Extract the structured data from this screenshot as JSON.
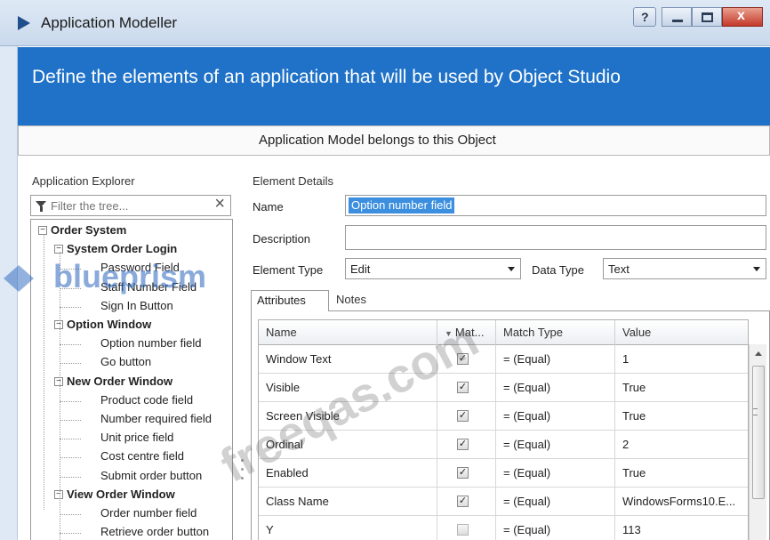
{
  "window": {
    "title": "Application Modeller",
    "help_glyph": "?",
    "close_glyph": "x"
  },
  "banner": {
    "text": "Define the elements of an application that will be used by Object Studio"
  },
  "model_bar": {
    "text": "Application Model belongs to this Object"
  },
  "explorer": {
    "title": "Application Explorer",
    "filter_placeholder": "Filter the tree...",
    "tree": [
      {
        "label": "Order System",
        "level": 0,
        "bold": true
      },
      {
        "label": "System Order Login",
        "level": 1,
        "bold": true
      },
      {
        "label": "Password Field",
        "level": 2,
        "bold": false
      },
      {
        "label": "Staff Number Field",
        "level": 2,
        "bold": false
      },
      {
        "label": "Sign In Button",
        "level": 2,
        "bold": false
      },
      {
        "label": "Option Window",
        "level": 1,
        "bold": true
      },
      {
        "label": "Option number field",
        "level": 2,
        "bold": false
      },
      {
        "label": "Go button",
        "level": 2,
        "bold": false
      },
      {
        "label": "New Order Window",
        "level": 1,
        "bold": true
      },
      {
        "label": "Product code field",
        "level": 2,
        "bold": false
      },
      {
        "label": "Number required field",
        "level": 2,
        "bold": false
      },
      {
        "label": "Unit price field",
        "level": 2,
        "bold": false
      },
      {
        "label": "Cost centre field",
        "level": 2,
        "bold": false
      },
      {
        "label": "Submit order button",
        "level": 2,
        "bold": false
      },
      {
        "label": "View Order Window",
        "level": 1,
        "bold": true
      },
      {
        "label": "Order number field",
        "level": 2,
        "bold": false
      },
      {
        "label": "Retrieve order button",
        "level": 2,
        "bold": false
      }
    ]
  },
  "details": {
    "title": "Element Details",
    "name_label": "Name",
    "name_value": "Option number field",
    "description_label": "Description",
    "description_value": "",
    "element_type_label": "Element Type",
    "element_type_value": "Edit",
    "data_type_label": "Data Type",
    "data_type_value": "Text"
  },
  "tabs": {
    "attributes": "Attributes",
    "notes": "Notes"
  },
  "grid": {
    "headers": {
      "name": "Name",
      "match": "Mat...",
      "match_type": "Match Type",
      "value": "Value"
    },
    "rows": [
      {
        "name": "Window Text",
        "match": true,
        "match_type": "= (Equal)",
        "value": "1"
      },
      {
        "name": "Visible",
        "match": true,
        "match_type": "= (Equal)",
        "value": "True"
      },
      {
        "name": "Screen Visible",
        "match": true,
        "match_type": "= (Equal)",
        "value": "True"
      },
      {
        "name": "Ordinal",
        "match": true,
        "match_type": "= (Equal)",
        "value": "2"
      },
      {
        "name": "Enabled",
        "match": true,
        "match_type": "= (Equal)",
        "value": "True"
      },
      {
        "name": "Class Name",
        "match": true,
        "match_type": "= (Equal)",
        "value": "WindowsForms10.E..."
      },
      {
        "name": "Y",
        "match": false,
        "match_type": "= (Equal)",
        "value": "113"
      }
    ]
  },
  "watermarks": {
    "brand": "blueprism",
    "site": "freeqas.com"
  }
}
